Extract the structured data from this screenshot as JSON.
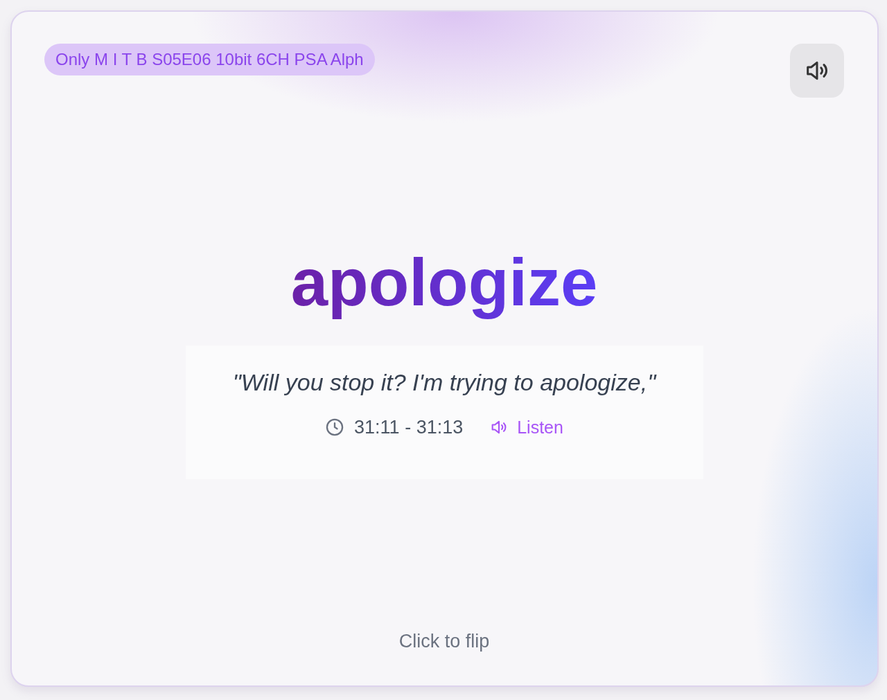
{
  "source_tag": "Only M I T B S05E06 10bit 6CH PSA Alph",
  "word": "apologize",
  "example": {
    "quote": "\"Will you stop it? I'm trying to apologize,\"",
    "timestamp": "31:11 - 31:13",
    "listen": "Listen"
  },
  "hint": "Click to flip"
}
